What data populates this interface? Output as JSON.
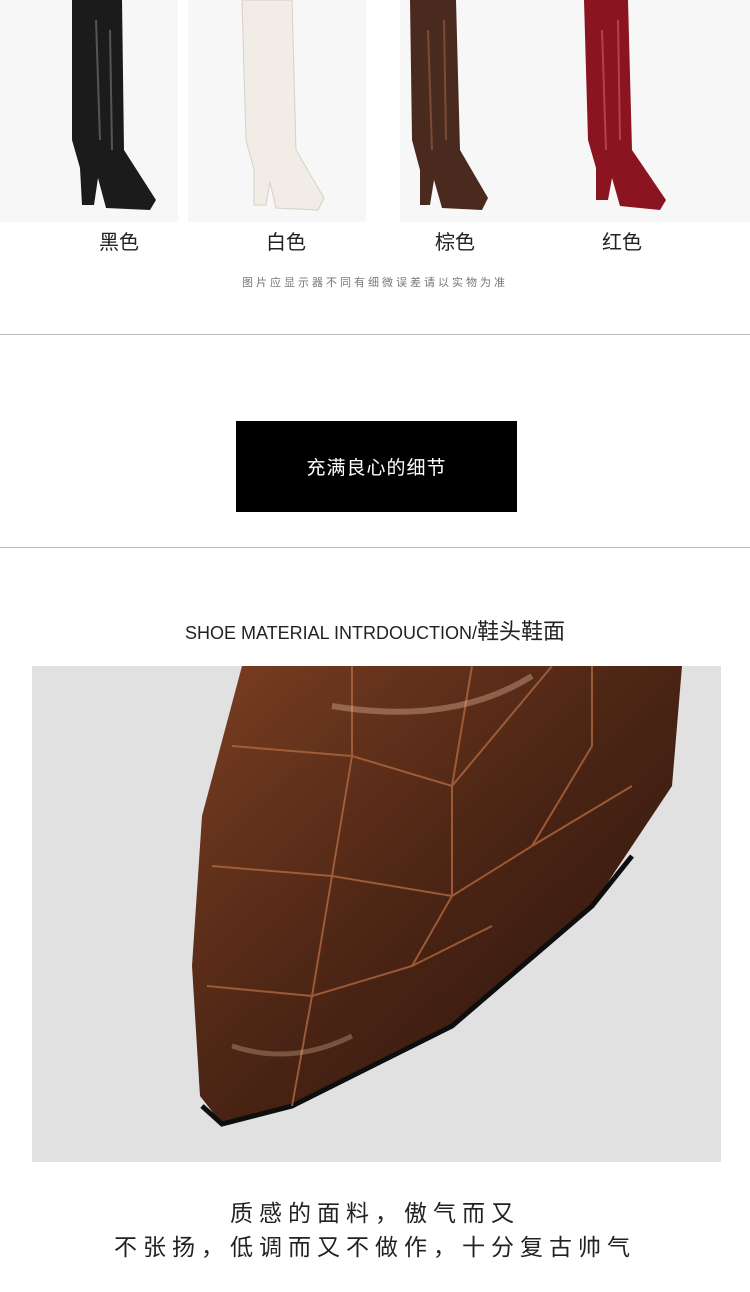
{
  "colors": {
    "labels": [
      "黑色",
      "白色",
      "棕色",
      "红色"
    ],
    "boot_fills": [
      "#1b1b1b",
      "#f1ede6",
      "#4a2a1f",
      "#8a1420"
    ]
  },
  "disclaimer": "图片应显示器不同有细微误差请以实物为准",
  "banner": {
    "text": "充满良心的细节"
  },
  "section": {
    "title_en": "SHOE MATERIAL INTRDOUCTION/",
    "title_cn": "鞋头鞋面"
  },
  "caption": {
    "line1": "质感的面料，傲气而又",
    "line2": "不张扬，低调而又不做作，十分复古帅气"
  },
  "theme": {
    "banner_bg": "#000000",
    "photo_bg": "#e1e1e1",
    "leather": "#5a2e1c"
  }
}
